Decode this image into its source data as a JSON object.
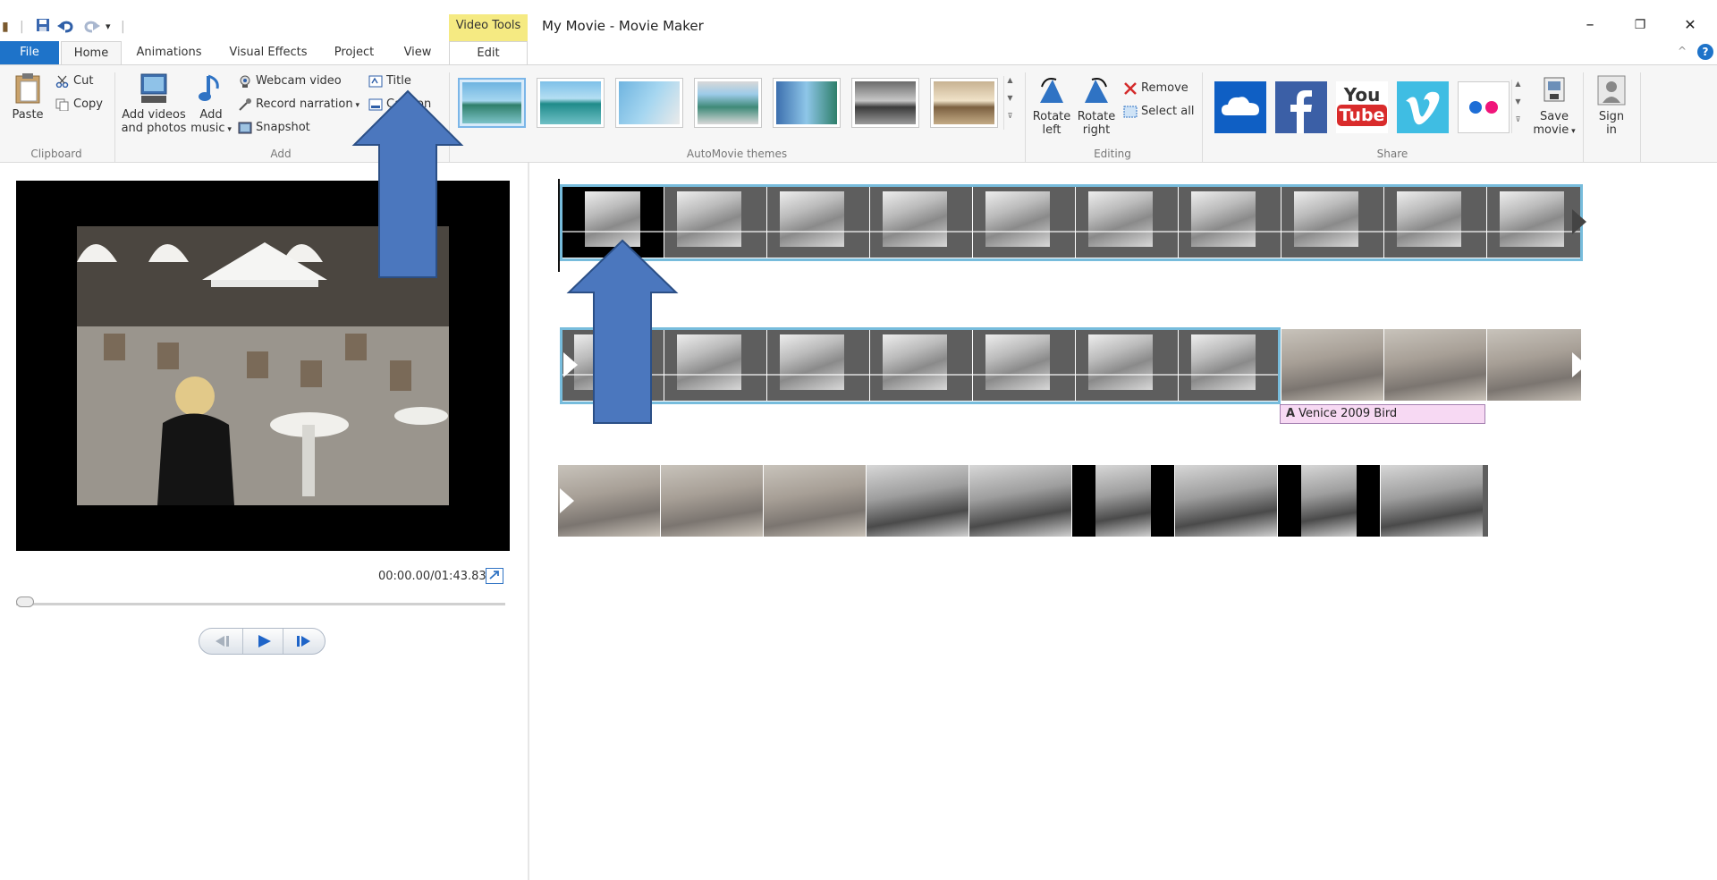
{
  "window": {
    "title": "My Movie - Movie Maker",
    "context_tab": "Video Tools",
    "controls": {
      "minimize": "–",
      "restore": "❐",
      "close": "✕"
    }
  },
  "tabs": {
    "file": "File",
    "home": "Home",
    "animations": "Animations",
    "visual_effects": "Visual Effects",
    "project": "Project",
    "view": "View",
    "edit": "Edit"
  },
  "ribbon": {
    "clipboard": {
      "paste": "Paste",
      "cut": "Cut",
      "copy": "Copy",
      "label": "Clipboard"
    },
    "add": {
      "add_videos_line1": "Add videos",
      "add_videos_line2": "and photos",
      "add_music_line1": "Add",
      "add_music_line2": "music",
      "webcam_video": "Webcam video",
      "record_narration": "Record narration",
      "snapshot": "Snapshot",
      "title": "Title",
      "caption": "Caption",
      "label": "Add"
    },
    "themes": {
      "label": "AutoMovie themes"
    },
    "editing": {
      "rotate_left_line1": "Rotate",
      "rotate_left_line2": "left",
      "rotate_right_line1": "Rotate",
      "rotate_right_line2": "right",
      "remove": "Remove",
      "select_all": "Select all",
      "label": "Editing"
    },
    "share": {
      "youtube_line1": "You",
      "youtube_line2": "Tube",
      "save_movie_line1": "Save",
      "save_movie_line2": "movie",
      "sign_in_line1": "Sign",
      "sign_in_line2": "in",
      "label": "Share"
    }
  },
  "preview": {
    "time": "00:00.00/01:43.83",
    "progress": 0.0
  },
  "storyboard": {
    "caption_text": "Venice 2009 Bird"
  },
  "colors": {
    "file_tab": "#1e73c9",
    "context_tab": "#f5ea82",
    "selection_border": "#77bcdc",
    "caption_bg": "#f7d9f3",
    "arrow_fill": "#4b77be",
    "arrow_stroke": "#2b4f86"
  }
}
